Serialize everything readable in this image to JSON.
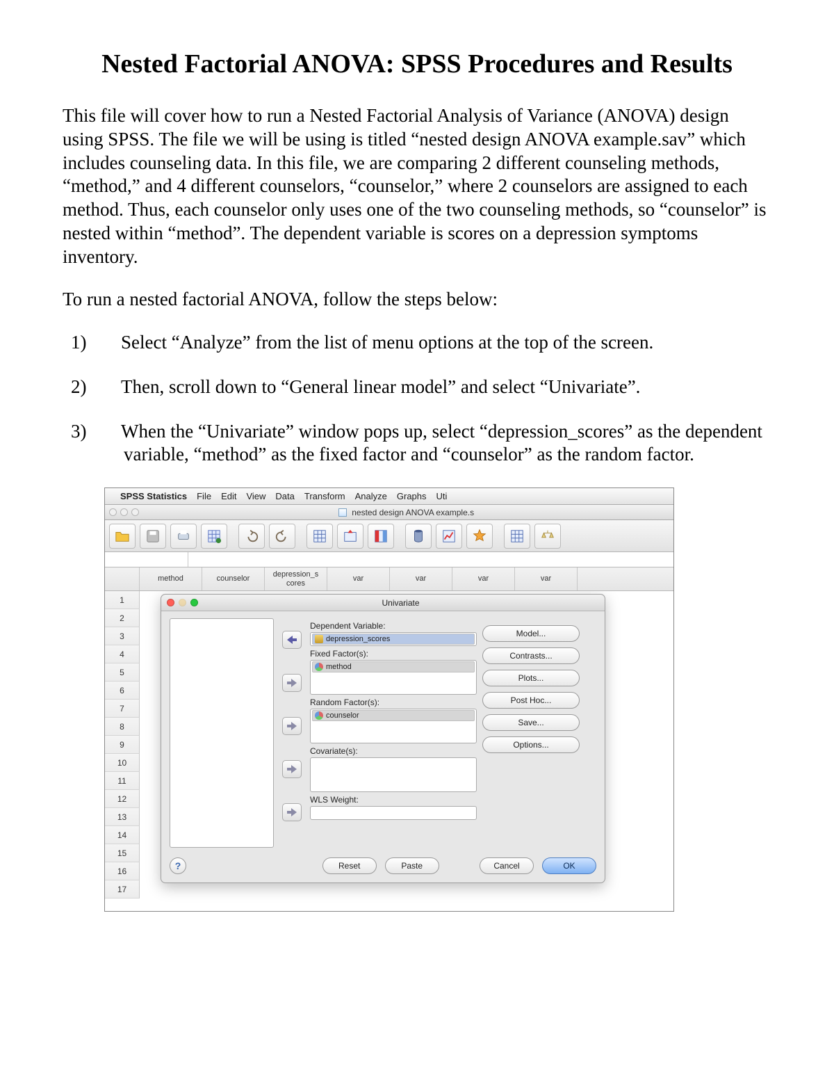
{
  "doc": {
    "title": "Nested Factorial ANOVA: SPSS Procedures and Results",
    "intro": "This file will cover how to run a Nested Factorial Analysis of Variance (ANOVA) design using SPSS. The file we will be using is titled “nested design ANOVA example.sav” which includes counseling data. In this file, we are comparing 2 different counseling methods, “method,” and 4 different counselors, “counselor,” where 2 counselors are assigned to each method. Thus, each counselor only uses one of the two counseling methods, so “counselor” is nested within “method”. The dependent variable is scores on a depression symptoms inventory.",
    "lead": "To run a nested factorial ANOVA, follow the steps below:",
    "steps": [
      "Select “Analyze” from the list of menu options at the top of the screen.",
      "Then, scroll down to “General linear model” and select “Univariate”.",
      "When the “Univariate” window pops up, select “depression_scores” as the dependent variable, “method” as the fixed factor and “counselor” as the random factor."
    ]
  },
  "menubar": {
    "app": "SPSS Statistics",
    "items": [
      "File",
      "Edit",
      "View",
      "Data",
      "Transform",
      "Analyze",
      "Graphs",
      "Uti"
    ]
  },
  "window_title": "nested design ANOVA example.s",
  "columns": [
    "method",
    "counselor",
    "depression_s\ncores",
    "var",
    "var",
    "var",
    "var"
  ],
  "rows": [
    "1",
    "2",
    "3",
    "4",
    "5",
    "6",
    "7",
    "8",
    "9",
    "10",
    "11",
    "12",
    "13",
    "14",
    "15",
    "16",
    "17"
  ],
  "dialog": {
    "title": "Univariate",
    "labels": {
      "dep": "Dependent Variable:",
      "fixed": "Fixed Factor(s):",
      "random": "Random Factor(s):",
      "cov": "Covariate(s):",
      "wls": "WLS Weight:"
    },
    "vars": {
      "dep": "depression_scores",
      "fixed": "method",
      "random": "counselor"
    },
    "right_buttons": [
      "Model...",
      "Contrasts...",
      "Plots...",
      "Post Hoc...",
      "Save...",
      "Options..."
    ],
    "foot": {
      "reset": "Reset",
      "paste": "Paste",
      "cancel": "Cancel",
      "ok": "OK"
    }
  }
}
